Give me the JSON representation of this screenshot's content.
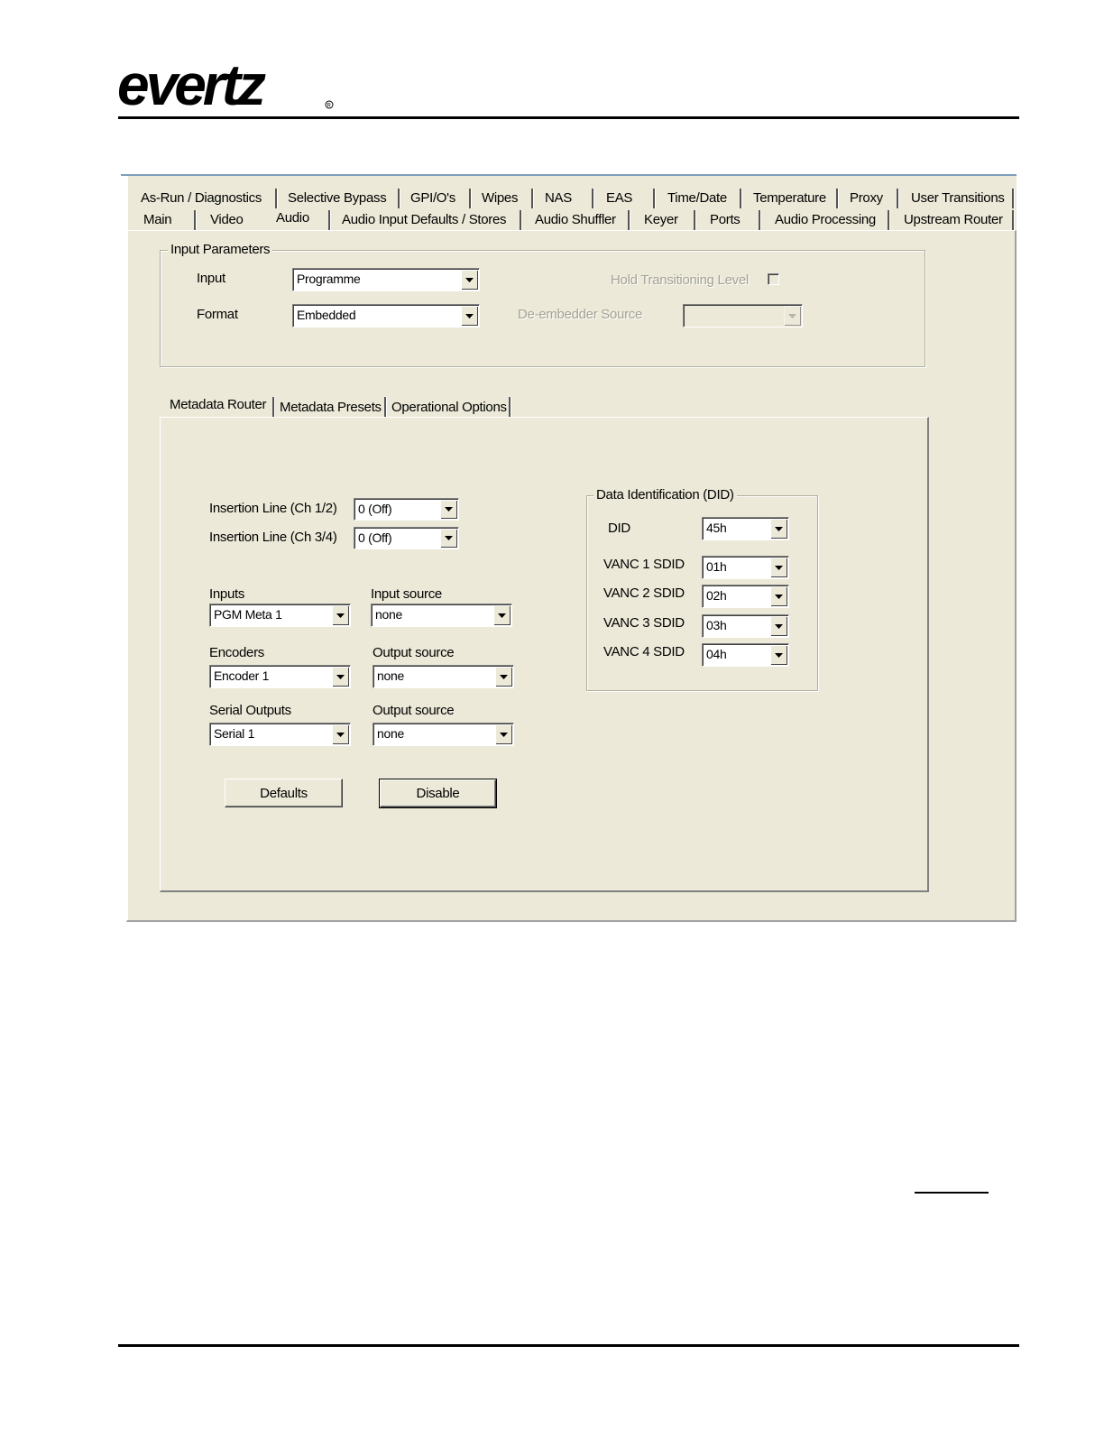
{
  "header": {
    "brand": "evertz"
  },
  "tabs": {
    "row_top": [
      "As-Run / Diagnostics",
      "Selective Bypass",
      "GPI/O's",
      "Wipes",
      "NAS",
      "EAS",
      "Time/Date",
      "Temperature",
      "Proxy",
      "User Transitions"
    ],
    "row_bottom": [
      "Main",
      "Video",
      "Audio",
      "Audio Input Defaults / Stores",
      "Audio Shuffler",
      "Keyer",
      "Ports",
      "Audio Processing",
      "Upstream Router"
    ],
    "active": "Audio"
  },
  "input_parameters": {
    "title": "Input Parameters",
    "input_label": "Input",
    "input_value": "Programme",
    "format_label": "Format",
    "format_value": "Embedded",
    "hold_label": "Hold Transitioning Level",
    "deembedder_label": "De-embedder Source",
    "deembedder_value": ""
  },
  "subtabs": {
    "items": [
      "Metadata Router",
      "Metadata Presets",
      "Operational Options"
    ],
    "active": "Metadata Router"
  },
  "metadata_router": {
    "insertion_line_12_label": "Insertion Line (Ch 1/2)",
    "insertion_line_12_value": "0 (Off)",
    "insertion_line_34_label": "Insertion Line (Ch 3/4)",
    "insertion_line_34_value": "0 (Off)",
    "inputs_label": "Inputs",
    "inputs_value": "PGM Meta 1",
    "input_source_label": "Input source",
    "input_source_value": "none",
    "encoders_label": "Encoders",
    "encoders_value": "Encoder 1",
    "encoder_output_source_label": "Output source",
    "encoder_output_source_value": "none",
    "serial_outputs_label": "Serial Outputs",
    "serial_outputs_value": "Serial 1",
    "serial_output_source_label": "Output source",
    "serial_output_source_value": "none",
    "defaults_button": "Defaults",
    "disable_button": "Disable"
  },
  "did": {
    "title": "Data Identification (DID)",
    "did_label": "DID",
    "did_value": "45h",
    "vanc1_label": "VANC 1 SDID",
    "vanc1_value": "01h",
    "vanc2_label": "VANC 2 SDID",
    "vanc2_value": "02h",
    "vanc3_label": "VANC 3 SDID",
    "vanc3_value": "03h",
    "vanc4_label": "VANC 4 SDID",
    "vanc4_value": "04h"
  }
}
